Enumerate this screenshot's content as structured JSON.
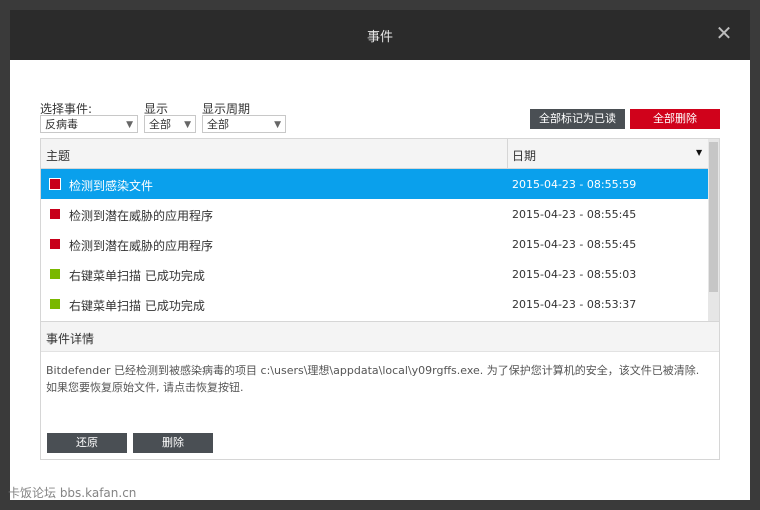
{
  "window": {
    "title": "事件"
  },
  "filters": {
    "event_label": "选择事件:",
    "event_value": "反病毒",
    "show_label": "显示",
    "show_value": "全部",
    "period_label": "显示周期",
    "period_value": "全部"
  },
  "actions": {
    "mark_all_read": "全部标记为已读",
    "delete_all": "全部删除"
  },
  "table": {
    "col_subject": "主题",
    "col_date": "日期",
    "rows": [
      {
        "subject": "检测到感染文件",
        "date": "2015-04-23 - 08:55:59",
        "color": "#c8001a",
        "selected": true
      },
      {
        "subject": "检测到潜在威胁的应用程序",
        "date": "2015-04-23 - 08:55:45",
        "color": "#c8001a"
      },
      {
        "subject": "检测到潜在威胁的应用程序",
        "date": "2015-04-23 - 08:55:45",
        "color": "#c8001a"
      },
      {
        "subject": "右键菜单扫描 已成功完成",
        "date": "2015-04-23 - 08:55:03",
        "color": "#7ab800"
      },
      {
        "subject": "右键菜单扫描 已成功完成",
        "date": "2015-04-23 - 08:53:37",
        "color": "#7ab800"
      }
    ]
  },
  "details": {
    "title": "事件详情",
    "line1": "Bitdefender 已经检测到被感染病毒的项目 c:\\users\\理想\\appdata\\local\\y09rgffs.exe. 为了保护您计算机的安全，该文件已被清除.",
    "line2": "如果您要恢复原始文件, 请点击恢复按钮.",
    "restore_button": "还原",
    "delete_button": "删除"
  },
  "watermark": "卡饭论坛 bbs.kafan.cn",
  "colors": {
    "accent": "#0aa0ec",
    "danger": "#d0021b",
    "dark_button": "#4a4f54"
  }
}
